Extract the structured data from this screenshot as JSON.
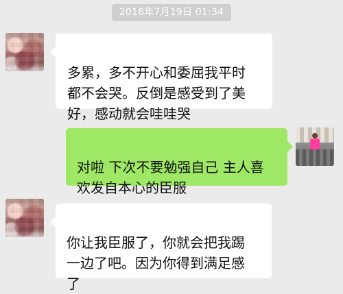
{
  "chat": {
    "timestamp": "2016年7月19日 01:34",
    "messages": [
      {
        "side": "left",
        "text": "多累，多不开心和委屈我平时\n都不会哭。反倒是感受到了美\n好，感动就会哇哇哭"
      },
      {
        "side": "right",
        "text": "对啦 下次不要勉强自己 主人喜\n欢发自本心的臣服"
      },
      {
        "side": "left",
        "text": "你让我臣服了，你就会把我踢\n一边了吧。因为你得到满足感\n了"
      }
    ]
  },
  "colors": {
    "background": "#ebebeb",
    "timestamp_bg": "#cfcfcf",
    "incoming_bubble": "#ffffff",
    "outgoing_bubble": "#9fe866",
    "text": "#111111"
  }
}
